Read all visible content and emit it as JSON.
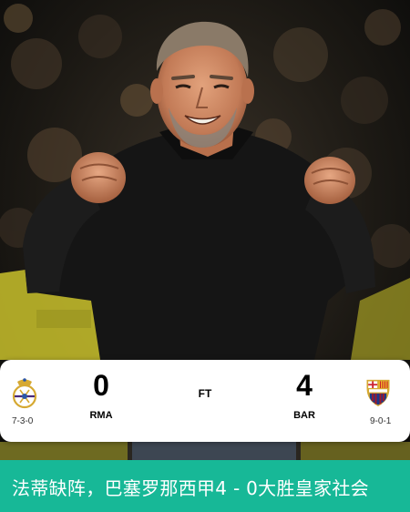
{
  "match": {
    "home": {
      "abbr": "RMA",
      "score": "0",
      "record": "7-3-0"
    },
    "away": {
      "abbr": "BAR",
      "score": "4",
      "record": "9-0-1"
    },
    "status": "FT"
  },
  "caption": "法蒂缺阵，巴塞罗那西甲4 - 0大胜皇家社会",
  "colors": {
    "caption_bg": "#17b897",
    "card_bg": "#ffffff",
    "jacket": "#141414"
  },
  "icons": {
    "home_crest": "real-madrid-crest-icon",
    "away_crest": "barcelona-crest-icon"
  }
}
